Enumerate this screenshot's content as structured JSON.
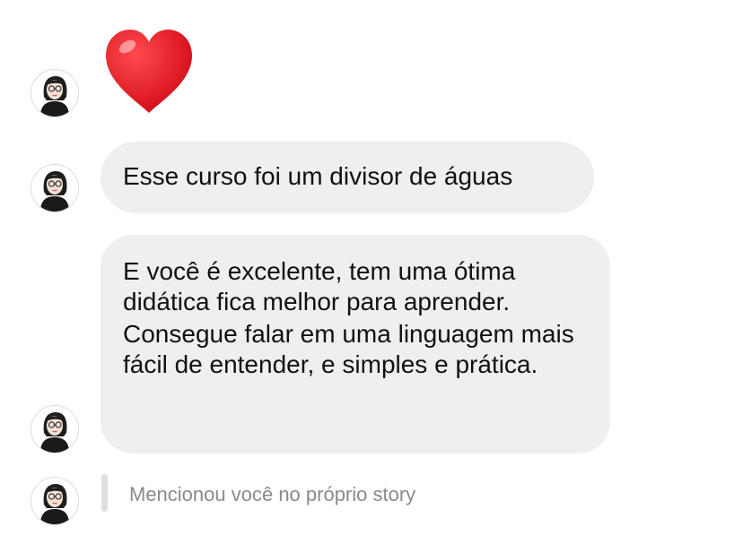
{
  "conversation": {
    "reaction": {
      "icon": "heart-emoji",
      "color": "#e8141c"
    },
    "messages": [
      {
        "text": "Esse curso foi um divisor de águas"
      },
      {
        "paragraphs": [
          "E você é excelente, tem uma ótima didática fica melhor para aprender.",
          "Consegue falar em uma linguagem mais fácil de entender, e simples e prática."
        ]
      }
    ],
    "story_mention": "Mencionou você no próprio story"
  },
  "colors": {
    "bubble_background": "#efeff0",
    "text": "#111111",
    "muted_text": "#8a8a8e"
  }
}
